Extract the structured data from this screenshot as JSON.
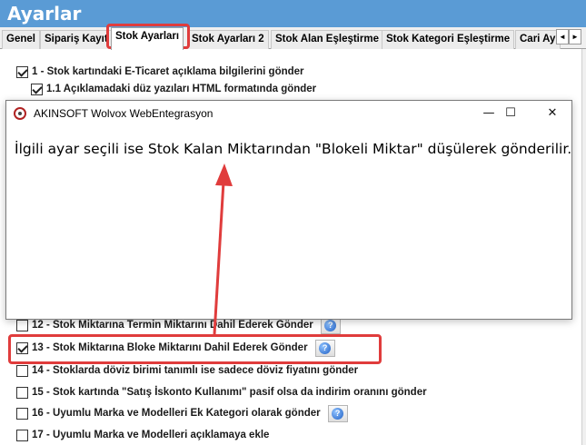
{
  "window": {
    "title": "Ayarlar"
  },
  "tabs": [
    {
      "label": "Genel"
    },
    {
      "label": "Sipariş Kayıt"
    },
    {
      "label": "Stok Ayarları",
      "active": true
    },
    {
      "label": "Stok Ayarları 2"
    },
    {
      "label": "Stok Alan Eşleştirme"
    },
    {
      "label": "Stok Kategori Eşleştirme"
    },
    {
      "label": "Cari Ay"
    }
  ],
  "tab_scroll": {
    "left": "◄",
    "right": "►"
  },
  "options": [
    {
      "label": "1 - Stok kartındaki E-Ticaret açıklama bilgilerini gönder",
      "checked": true
    },
    {
      "label": "1.1 Açıklamadaki düz yazıları HTML formatında gönder",
      "checked": true
    },
    {
      "label": "12 - Stok Miktarına Termin Miktarını Dahil Ederek Gönder",
      "checked": false,
      "help": true
    },
    {
      "label": "13 - Stok Miktarına Bloke Miktarını Dahil Ederek Gönder",
      "checked": true,
      "help": true
    },
    {
      "label": "14 - Stoklarda döviz birimi tanımlı ise sadece döviz fiyatını gönder",
      "checked": false
    },
    {
      "label": "15 - Stok kartında \"Satış İskonto Kullanımı\" pasif olsa da indirim oranını gönder",
      "checked": false
    },
    {
      "label": "16 - Uyumlu Marka ve Modelleri Ek Kategori olarak gönder",
      "checked": false,
      "help": true
    },
    {
      "label": "17 - Uyumlu Marka ve Modelleri açıklamaya ekle",
      "checked": false
    }
  ],
  "help_glyph": "?",
  "dialog": {
    "title": "AKINSOFT Wolvox WebEntegrasyon",
    "message": "İlgili ayar seçili ise Stok Kalan Miktarından \"Blokeli Miktar\" düşülerek gönderilir.",
    "minimize": "—",
    "maximize": "☐",
    "close": "✕"
  },
  "colors": {
    "titlebar": "#5a9bd5",
    "highlight": "#e03c3c"
  }
}
